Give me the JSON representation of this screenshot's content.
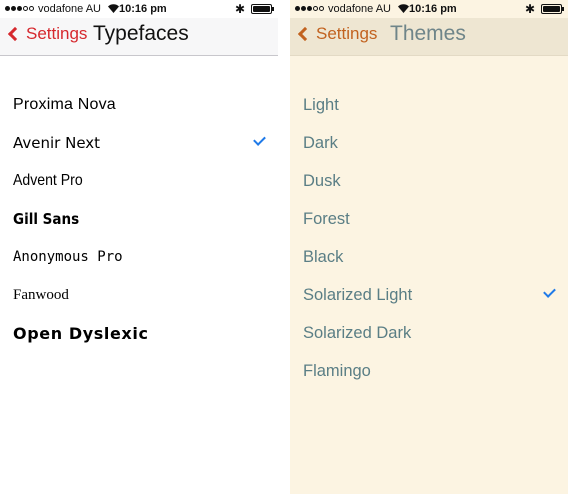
{
  "status": {
    "carrier": "vodafone AU",
    "time": "10:16 pm"
  },
  "typefaces_screen": {
    "back_label": "Settings",
    "title": "Typefaces",
    "items": [
      {
        "label": "Proxima Nova",
        "selected": false
      },
      {
        "label": "Avenir Next",
        "selected": true
      },
      {
        "label": "Advent Pro",
        "selected": false
      },
      {
        "label": "Gill Sans",
        "selected": false
      },
      {
        "label": "Anonymous Pro",
        "selected": false
      },
      {
        "label": "Fanwood",
        "selected": false
      },
      {
        "label": "Open Dyslexic",
        "selected": false
      }
    ]
  },
  "themes_screen": {
    "back_label": "Settings",
    "title": "Themes",
    "items": [
      {
        "label": "Light",
        "selected": false
      },
      {
        "label": "Dark",
        "selected": false
      },
      {
        "label": "Dusk",
        "selected": false
      },
      {
        "label": "Forest",
        "selected": false
      },
      {
        "label": "Black",
        "selected": false
      },
      {
        "label": "Solarized Light",
        "selected": true
      },
      {
        "label": "Solarized Dark",
        "selected": false
      },
      {
        "label": "Flamingo",
        "selected": false
      }
    ]
  },
  "colors": {
    "typefaces_accent": "#d6282e",
    "themes_accent": "#c2621f",
    "checkmark": "#1f7ae8",
    "themes_background": "#fcf4e2"
  }
}
